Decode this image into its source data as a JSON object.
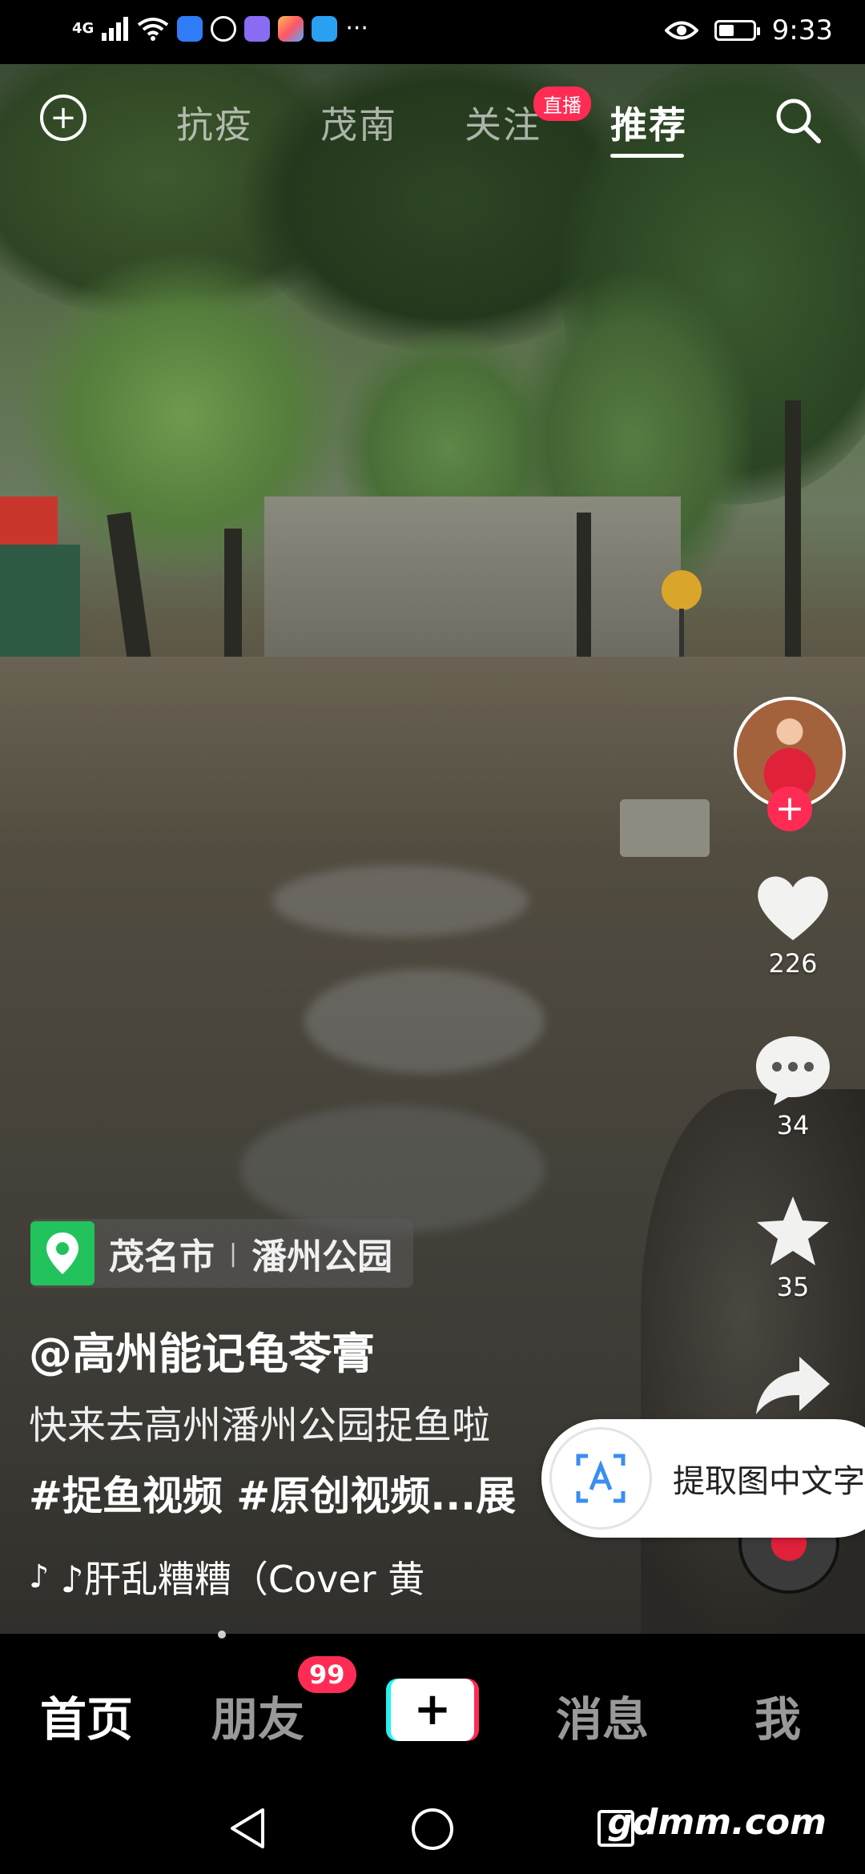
{
  "status_bar": {
    "signal": "4G",
    "time": "9:33",
    "battery_level": 0.45,
    "more": "···"
  },
  "top_nav": {
    "tabs": [
      {
        "label": "抗疫",
        "active": false
      },
      {
        "label": "茂南",
        "active": false
      },
      {
        "label": "关注",
        "active": false
      },
      {
        "label": "推荐",
        "active": true
      }
    ],
    "live_badge": "直播"
  },
  "rail": {
    "likes": "226",
    "comments": "34",
    "favorites": "35"
  },
  "post": {
    "location_city": "茂名市",
    "location_place": "潘州公园",
    "author": "@高州能记龟苓膏",
    "description": "快来去高州潘州公园捉鱼啦",
    "tags": "#捉鱼视频 #原创视频...展",
    "music": "♪肝乱糟糟（Cover 黄"
  },
  "ocr_popup": {
    "label": "提取图中文字"
  },
  "tab_bar": {
    "home": "首页",
    "friends": "朋友",
    "friends_badge": "99",
    "messages": "消息",
    "me": "我"
  },
  "watermark": "gdmm.com",
  "colors": {
    "accent_red": "#fe2c55",
    "accent_cyan": "#25f4ee",
    "location_green": "#22c35d"
  }
}
